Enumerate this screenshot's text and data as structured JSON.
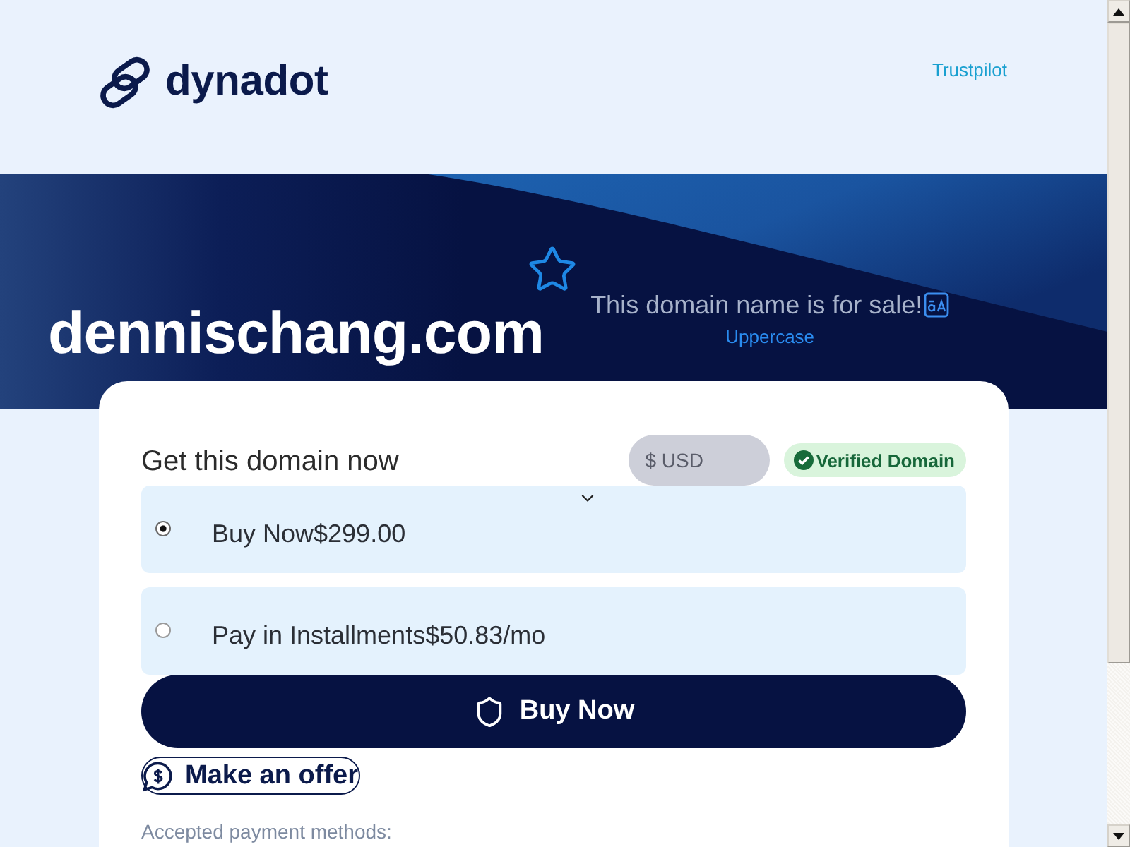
{
  "header": {
    "logo_text": "dynadot",
    "links": [
      {
        "label": "Trustpilot"
      }
    ]
  },
  "hero": {
    "domain": "dennischang.com",
    "sale_message": "This domain name is for sale!",
    "case_toggle": "Uppercase"
  },
  "purchase_card": {
    "title": "Get this domain now",
    "currency": {
      "value": "$ USD"
    },
    "badge": {
      "label": "Verified Domain"
    },
    "options": [
      {
        "label": "Buy Now$299.00",
        "selected": true
      },
      {
        "label": "Pay in Installments$50.83/mo",
        "selected": false
      }
    ],
    "primary_button": "Buy Now",
    "secondary_button": "Make an offer",
    "payment_methods_label": "Accepted payment methods:"
  }
}
